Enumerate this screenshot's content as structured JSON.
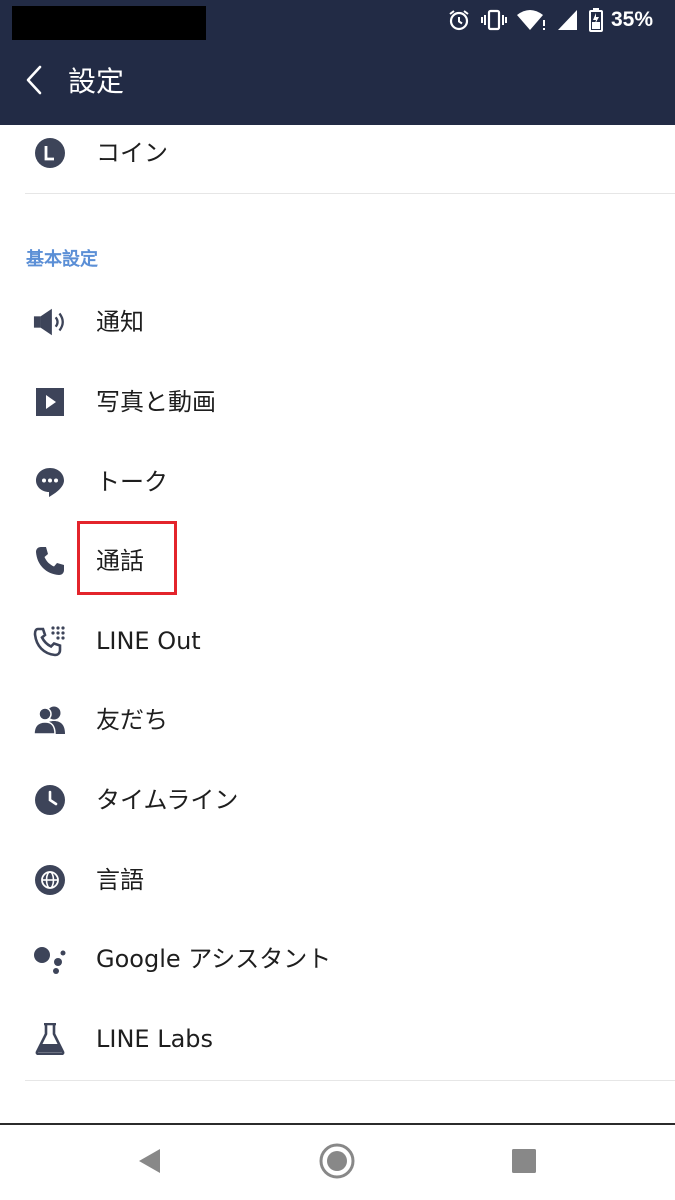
{
  "status_bar": {
    "battery_text": "35%",
    "icons": [
      "alarm-icon",
      "vibrate-icon",
      "wifi-icon",
      "signal-icon",
      "battery-icon"
    ]
  },
  "header": {
    "title": "設定",
    "back_icon": "chevron-left-icon"
  },
  "top_item": {
    "label": "コイン",
    "icon": "coin-icon"
  },
  "section": {
    "title": "基本設定",
    "items": [
      {
        "label": "通知",
        "icon": "speaker-icon"
      },
      {
        "label": "写真と動画",
        "icon": "play-icon"
      },
      {
        "label": "トーク",
        "icon": "chat-icon"
      },
      {
        "label": "通話",
        "icon": "phone-icon"
      },
      {
        "label": "LINE Out",
        "icon": "phone-dial-icon"
      },
      {
        "label": "友だち",
        "icon": "friends-icon"
      },
      {
        "label": "タイムライン",
        "icon": "clock-icon"
      },
      {
        "label": "言語",
        "icon": "globe-icon"
      },
      {
        "label": "Google アシスタント",
        "icon": "assistant-icon"
      },
      {
        "label": "LINE Labs",
        "icon": "flask-icon"
      }
    ]
  },
  "colors": {
    "header_bg": "#222b45",
    "icon": "#3d4459",
    "section_header": "#5b8fd6",
    "highlight": "#e3242b"
  },
  "nav_bar": {
    "icons": [
      "nav-back-icon",
      "nav-home-icon",
      "nav-recents-icon"
    ]
  }
}
